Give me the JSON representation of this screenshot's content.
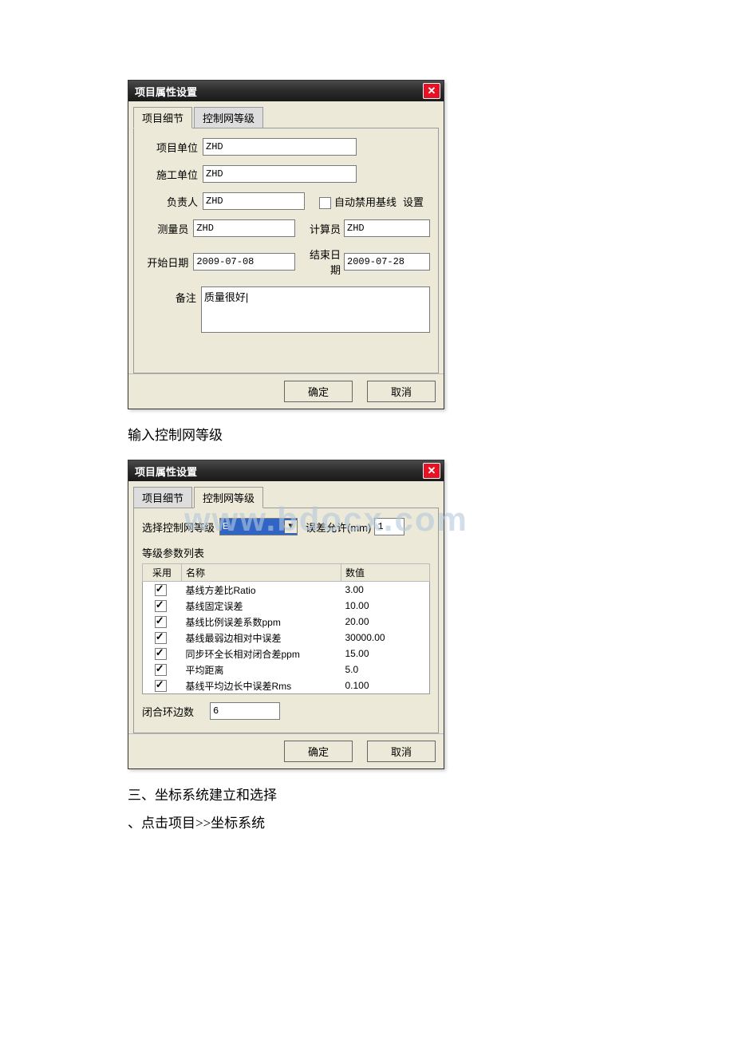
{
  "dialog1": {
    "title": "项目属性设置",
    "tabs": {
      "details": "项目细节",
      "level": "控制网等级"
    },
    "labels": {
      "project_unit": "项目单位",
      "construction_unit": "施工单位",
      "supervisor": "负责人",
      "surveyor": "测量员",
      "start_date": "开始日期",
      "remark": "备注",
      "auto_disable_baseline": "自动禁用基线",
      "settings": "设置",
      "calculator": "计算员",
      "end_date": "结束日期"
    },
    "values": {
      "project_unit": "ZHD",
      "construction_unit": "ZHD",
      "supervisor": "ZHD",
      "surveyor": "ZHD",
      "start_date": "2009-07-08",
      "calculator": "ZHD",
      "end_date": "2009-07-28",
      "remark": "质量很好|"
    },
    "buttons": {
      "ok": "确定",
      "cancel": "取消"
    }
  },
  "text_between": "输入控制网等级",
  "dialog2": {
    "title": "项目属性设置",
    "tabs": {
      "details": "项目细节",
      "level": "控制网等级"
    },
    "labels": {
      "select_level": "选择控制网等级",
      "tolerance": "误差允许(mm)",
      "params_header": "等级参数列表",
      "col_use": "采用",
      "col_name": "名称",
      "col_value": "数值",
      "loop_edges": "闭合环边数"
    },
    "values": {
      "level": "E",
      "tolerance": "1",
      "loop_edges": "6"
    },
    "params": [
      {
        "use": true,
        "name": "基线方差比Ratio",
        "value": "3.00"
      },
      {
        "use": true,
        "name": "基线固定误差",
        "value": "10.00"
      },
      {
        "use": true,
        "name": "基线比例误差系数ppm",
        "value": "20.00"
      },
      {
        "use": true,
        "name": "基线最弱边相对中误差",
        "value": "30000.00"
      },
      {
        "use": true,
        "name": "同步环全长相对闭合差ppm",
        "value": "15.00"
      },
      {
        "use": true,
        "name": "平均距离",
        "value": "5.0"
      },
      {
        "use": true,
        "name": "基线平均边长中误差Rms",
        "value": "0.100"
      }
    ],
    "buttons": {
      "ok": "确定",
      "cancel": "取消"
    }
  },
  "body_text": {
    "section3": "三、坐标系统建立和选择",
    "step": "、点击项目>>坐标系统"
  },
  "watermark": "www.bdocx.com"
}
